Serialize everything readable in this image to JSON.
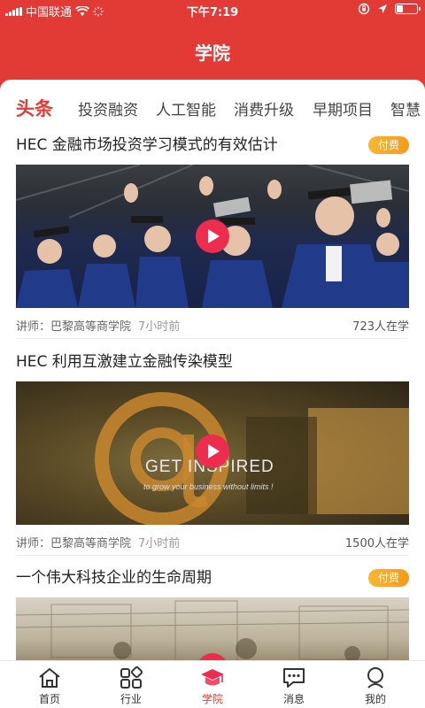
{
  "status_bar": {
    "carrier": "中国联通",
    "time": "下午7:19"
  },
  "header": {
    "title": "学院"
  },
  "tabs": [
    {
      "label": "头条",
      "active": true
    },
    {
      "label": "投资融资",
      "active": false
    },
    {
      "label": "人工智能",
      "active": false
    },
    {
      "label": "消费升级",
      "active": false
    },
    {
      "label": "早期项目",
      "active": false
    },
    {
      "label": "智慧",
      "active": false
    }
  ],
  "articles": [
    {
      "title": "HEC 金融市场投资学习模式的有效估计",
      "badge": "付费",
      "lecturer": "讲师：巴黎高等商学院",
      "time": "7小时前",
      "learners": "723人在学"
    },
    {
      "title": "HEC 利用互激建立金融传染模型",
      "badge": "",
      "lecturer": "讲师：巴黎高等商学院",
      "time": "7小时前",
      "learners": "1500人在学",
      "image_text": "GET INSPIRED",
      "image_subtext": "to grow your business without limits !"
    },
    {
      "title": "一个伟大科技企业的生命周期",
      "badge": "付费"
    }
  ],
  "tabbar": [
    {
      "label": "首页",
      "icon": "home-icon"
    },
    {
      "label": "行业",
      "icon": "grid-icon"
    },
    {
      "label": "学院",
      "icon": "graduation-cap-icon",
      "active": true
    },
    {
      "label": "消息",
      "icon": "message-icon"
    },
    {
      "label": "我的",
      "icon": "user-icon"
    }
  ],
  "colors": {
    "brand_red": "#e23a35",
    "badge_orange": "#f5a623",
    "play_red": "#ee2c4d"
  }
}
